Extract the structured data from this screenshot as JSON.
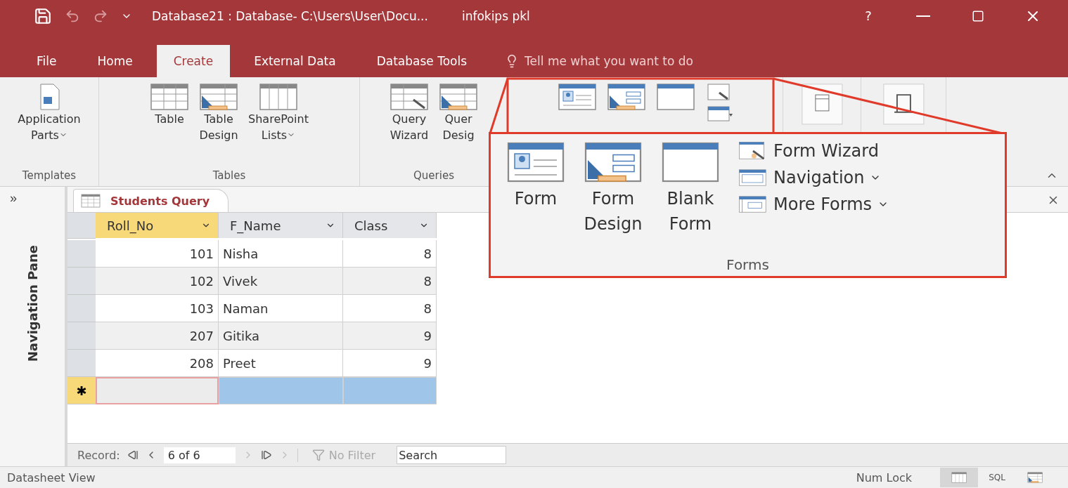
{
  "title_bar": {
    "document": "Database21 : Database- C:\\Users\\User\\Docu...",
    "user": "infokips pkl",
    "help": "?"
  },
  "ribbon_tabs": [
    {
      "label": "File",
      "selected": false
    },
    {
      "label": "Home",
      "selected": false
    },
    {
      "label": "Create",
      "selected": true
    },
    {
      "label": "External Data",
      "selected": false
    },
    {
      "label": "Database Tools",
      "selected": false
    }
  ],
  "tell_me": "Tell me what you want to do",
  "ribbon_groups": [
    {
      "label": "Templates",
      "buttons": [
        {
          "kind": "parts",
          "lines": [
            "Application",
            "Parts"
          ],
          "dropdown": true
        }
      ]
    },
    {
      "label": "Tables",
      "buttons": [
        {
          "kind": "table",
          "lines": [
            "Table"
          ],
          "dropdown": false
        },
        {
          "kind": "tabledesign",
          "lines": [
            "Table",
            "Design"
          ],
          "dropdown": false
        },
        {
          "kind": "list",
          "lines": [
            "SharePoint",
            "Lists"
          ],
          "dropdown": true
        }
      ]
    },
    {
      "label": "Queries",
      "buttons": [
        {
          "kind": "wizard",
          "lines": [
            "Query",
            "Wizard"
          ],
          "dropdown": false
        },
        {
          "kind": "querydesign",
          "lines": [
            "Quer",
            "Desig"
          ],
          "dropdown": false
        }
      ]
    },
    {
      "buttons": [
        {
          "kind": "form"
        },
        {
          "kind": "formdesign"
        },
        {
          "kind": "blank"
        },
        {
          "kind": "stack"
        }
      ]
    },
    {
      "buttons": [
        {
          "kind": "report"
        }
      ]
    },
    {
      "buttons": [
        {
          "kind": "macro"
        }
      ]
    }
  ],
  "callout": {
    "large": [
      {
        "kind": "form",
        "lines": [
          "Form"
        ]
      },
      {
        "kind": "formdesign",
        "lines": [
          "Form",
          "Design"
        ]
      },
      {
        "kind": "blank",
        "lines": [
          "Blank",
          "Form"
        ]
      }
    ],
    "small": [
      {
        "kind": "formwizard",
        "label": "Form Wizard",
        "dropdown": false
      },
      {
        "kind": "navigation",
        "label": "Navigation",
        "dropdown": true
      },
      {
        "kind": "moreforms",
        "label": "More Forms",
        "dropdown": true
      }
    ],
    "group_label": "Forms"
  },
  "nav_pane": {
    "toggle": "»",
    "label": "Navigation Pane"
  },
  "document_tab": {
    "label": "Students Query"
  },
  "datasheet": {
    "columns": [
      {
        "label": "Roll_No",
        "selected": true
      },
      {
        "label": "F_Name",
        "selected": false
      },
      {
        "label": "Class",
        "selected": false
      }
    ],
    "rows": [
      {
        "cells": [
          "101",
          "Nisha",
          "8"
        ]
      },
      {
        "cells": [
          "102",
          "Vivek",
          "8"
        ]
      },
      {
        "cells": [
          "103",
          "Naman",
          "8"
        ]
      },
      {
        "cells": [
          "207",
          "Gitika",
          "9"
        ]
      },
      {
        "cells": [
          "208",
          "Preet",
          "9"
        ]
      }
    ],
    "new_row": {
      "marker": "✱",
      "cells": [
        {
          "focused": true,
          "selected": false
        },
        {
          "focused": false,
          "selected": true
        },
        {
          "focused": false,
          "selected": true
        }
      ]
    }
  },
  "record_bar": {
    "label": "Record:",
    "position": "6 of 6",
    "filter": "No Filter",
    "search_placeholder": "Search"
  },
  "status_bar": {
    "view": "Datasheet View",
    "num_lock": "Num Lock",
    "views": [
      {
        "kind": "datasheet",
        "selected": true
      },
      {
        "kind": "sql",
        "label": "SQL",
        "selected": false
      },
      {
        "kind": "design",
        "selected": false
      }
    ]
  }
}
